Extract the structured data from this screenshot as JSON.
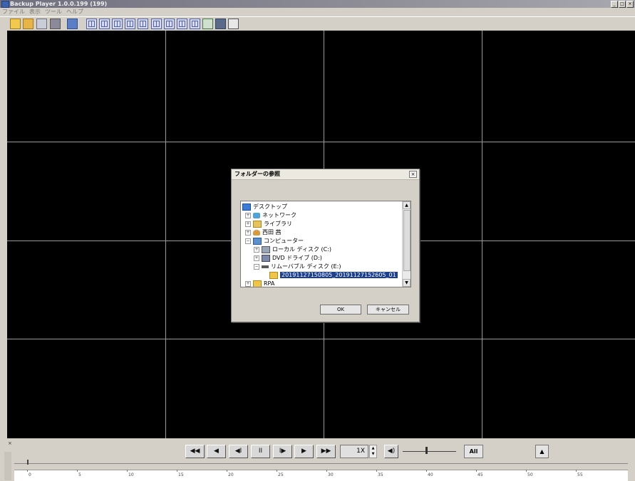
{
  "window": {
    "title": "Backup Player 1.0.0.199 (199)",
    "controls": [
      "_",
      "□",
      "×"
    ]
  },
  "menu": [
    "ファイル",
    "表示",
    "ツール",
    "ヘルプ"
  ],
  "toolbar": {
    "buttons": [
      "open-folder-icon",
      "open-file-icon",
      "print-icon",
      "camera-icon",
      "search-icon",
      "layout-1-icon",
      "layout-4-icon",
      "layout-6-icon",
      "layout-9-icon",
      "layout-16-icon",
      "layout-cycle-icon",
      "prev-icon",
      "next-icon",
      "seq-icon",
      "snapshot-icon",
      "tv-icon",
      "capture-icon"
    ]
  },
  "dialog": {
    "title": "フォルダーの参照",
    "close": "×",
    "tree": [
      {
        "label": "デスクトップ",
        "icon": "desktop",
        "level": 0,
        "exp": ""
      },
      {
        "label": "ネットワーク",
        "icon": "network",
        "level": 1,
        "exp": "+"
      },
      {
        "label": "ライブラリ",
        "icon": "library",
        "level": 1,
        "exp": "+"
      },
      {
        "label": "西田 茜",
        "icon": "user",
        "level": 1,
        "exp": "+"
      },
      {
        "label": "コンピューター",
        "icon": "computer",
        "level": 1,
        "exp": "−"
      },
      {
        "label": "ローカル ディスク (C:)",
        "icon": "drive",
        "level": 2,
        "exp": "+"
      },
      {
        "label": "DVD ドライブ (D:)",
        "icon": "dvd",
        "level": 2,
        "exp": "+"
      },
      {
        "label": "リムーバブル ディスク (E:)",
        "icon": "removable",
        "level": 2,
        "exp": "−"
      },
      {
        "label": "20191127150805_20191127152605_01",
        "icon": "folder",
        "level": 3,
        "exp": "",
        "selected": true
      },
      {
        "label": "RPA",
        "icon": "folder",
        "level": 1,
        "exp": "+"
      }
    ],
    "ok": "OK",
    "cancel": "キャンセル"
  },
  "playback": {
    "buttons": [
      "◀◀",
      "◀",
      "◀Ⅰ",
      "ⅠⅠ",
      "Ⅰ▶",
      "▶",
      "▶▶"
    ],
    "speed": "1X",
    "all": "All",
    "volume": 0.45,
    "eject": "▲",
    "collapse": "×"
  },
  "timeline": {
    "ticks": [
      "0",
      "5",
      "10",
      "15",
      "20",
      "25",
      "30",
      "35",
      "40",
      "45",
      "50",
      "55"
    ],
    "position": 0.02
  }
}
